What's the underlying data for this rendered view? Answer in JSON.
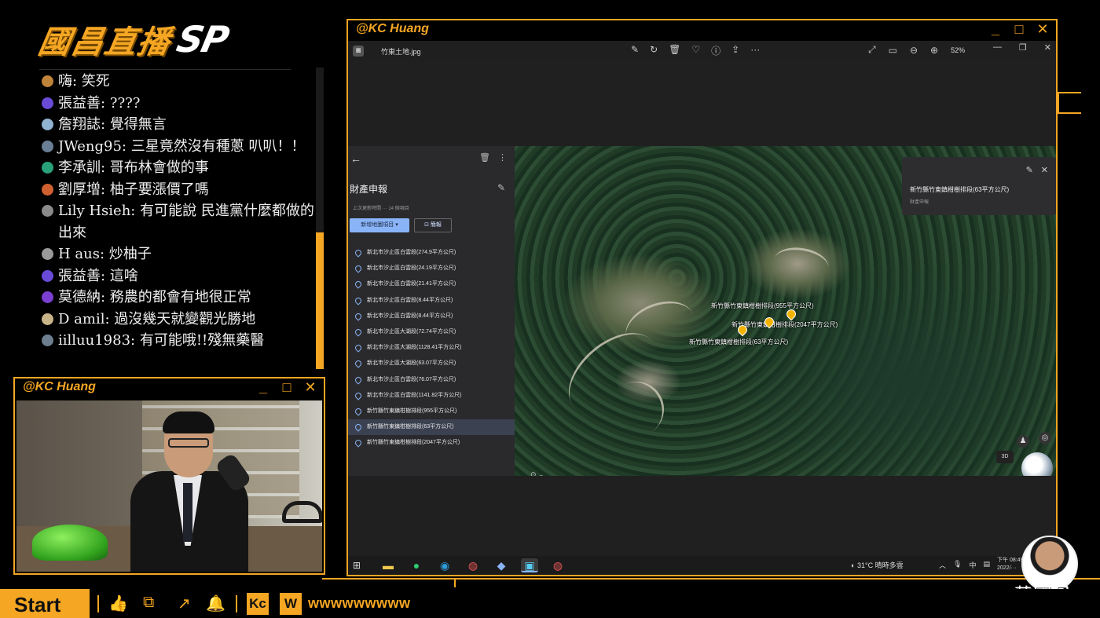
{
  "brand": {
    "logo_cn": "國昌直播",
    "logo_sp": "SP",
    "accent": "#f5a623"
  },
  "chat": {
    "messages": [
      {
        "user": "嗨",
        "text": "笑死",
        "avatar_color": "#c0833a"
      },
      {
        "user": "張益善",
        "text": "????",
        "avatar_color": "#6a4bd8"
      },
      {
        "user": "詹翔誌",
        "text": "覺得無言",
        "avatar_color": "#8fb3d0"
      },
      {
        "user": "JWeng95",
        "text": "三星竟然沒有種蔥 叭叭！！",
        "avatar_color": "#6a7f96"
      },
      {
        "user": "李承訓",
        "text": "哥布林會做的事",
        "avatar_color": "#28a07a"
      },
      {
        "user": "劉厚增",
        "text": "柚子要漲價了嗎",
        "avatar_color": "#d06030"
      },
      {
        "user": "Lily Hsieh",
        "text": "有可能說 民進黨什麼都做的出來",
        "avatar_color": "#8a8a8a"
      },
      {
        "user": "H aus",
        "text": "炒柚子",
        "avatar_color": "#9a9a9a"
      },
      {
        "user": "張益善",
        "text": "這啥",
        "avatar_color": "#6a4bd8"
      },
      {
        "user": "莫德納",
        "text": "務農的都會有地很正常",
        "avatar_color": "#7a3fd0"
      },
      {
        "user": "D amil",
        "text": "過沒幾天就變觀光勝地",
        "avatar_color": "#c9b48a"
      },
      {
        "user": "iilluu1983",
        "text": "有可能哦!!殘無藥醫",
        "avatar_color": "#6d7e8e"
      }
    ]
  },
  "webcam": {
    "title": "@KC Huang",
    "controls": [
      "_",
      "□",
      "✕"
    ]
  },
  "share": {
    "title": "@KC Huang",
    "controls": [
      "_",
      "□",
      "✕"
    ],
    "photo_viewer": {
      "file_name": "竹東土地.jpg",
      "tool_icons": [
        "edit-icon",
        "rotate-icon",
        "delete-icon",
        "heart-icon",
        "info-icon",
        "share-icon",
        "more-icon"
      ],
      "tool_glyphs": [
        "✎",
        "↻",
        "🗑",
        "♡",
        "ⓘ",
        "⇪",
        "···"
      ],
      "zoom": "52%"
    },
    "earth": {
      "panel_title": "財產申報",
      "meta": "上次更新時間 ···   14 個項目",
      "add_button": "新增地圖項目",
      "present_button": "簡報",
      "items": [
        "新北市汐止區白雲段(274.9平方公尺)",
        "新北市汐止區白雲段(24.19平方公尺)",
        "新北市汐止區白雲段(21.41平方公尺)",
        "新北市汐止區白雲段(8.44平方公尺)",
        "新北市汐止區白雲段(8.44平方公尺)",
        "新北市汐止區大湖段(72.74平方公尺)",
        "新北市汐止區大湖段(1128.41平方公尺)",
        "新北市汐止區大湖段(63.07平方公尺)",
        "新北市汐止區白雲段(76.07平方公尺)",
        "新北市汐止區白雲段(1141.82平方公尺)",
        "新竹縣竹東鎮柑樹排段(955平方公尺)",
        "新竹縣竹東鎮柑樹排段(63平方公尺)",
        "新竹縣竹東鎮柑樹排段(2047平方公尺)"
      ],
      "selected_index": 11,
      "map_labels": [
        "新竹縣竹東鎮柑樹排段(955平方公尺)",
        "新竹縣竹東鎮柑樹排段(2047平方公尺)",
        "新竹縣竹東鎮柑樹排段(63平方公尺)"
      ],
      "info_card": {
        "title": "新竹縣竹東鎮柑樹排段(63平方公尺)",
        "subtitle": "財產申報"
      },
      "view_3d": "3D"
    },
    "taskbar": {
      "weather": "31°C 晴時多雲",
      "ime": "中",
      "clock_line1": "下午 08:49",
      "clock_line2": "2022/···"
    }
  },
  "presenter": {
    "name": "黃國昌"
  },
  "bottom_bar": {
    "start_label": "Start",
    "icons": [
      "like-icon",
      "copy-icon",
      "share-icon",
      "bell-icon"
    ],
    "icon_glyphs": [
      "👍",
      "⧉",
      "↗",
      "🔔"
    ],
    "kc_label": "Kc",
    "w_label": "W",
    "ticker": "wwwwwwwww"
  }
}
